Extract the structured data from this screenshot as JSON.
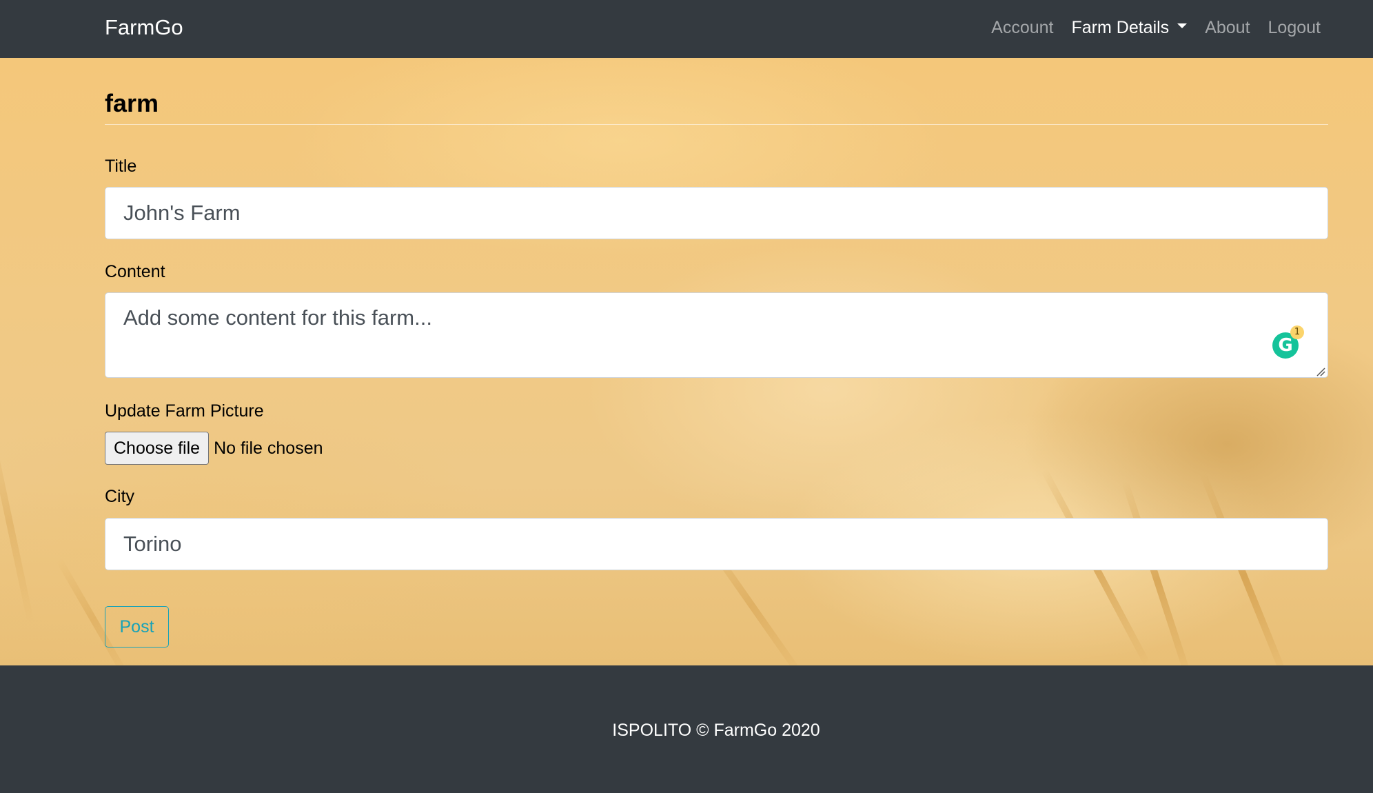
{
  "navbar": {
    "brand": "FarmGo",
    "links": [
      {
        "label": "Account",
        "active": false
      },
      {
        "label": "Farm Details",
        "active": true,
        "dropdown": true
      },
      {
        "label": "About",
        "active": false
      },
      {
        "label": "Logout",
        "active": false
      }
    ]
  },
  "form": {
    "heading": "farm",
    "title": {
      "label": "Title",
      "value": "John's Farm"
    },
    "content": {
      "label": "Content",
      "placeholder": "Add some content for this farm..."
    },
    "picture": {
      "label": "Update Farm Picture",
      "button": "Choose file",
      "status": "No file chosen"
    },
    "city": {
      "label": "City",
      "value": "Torino"
    },
    "submit": "Post"
  },
  "grammarly": {
    "icon": "grammarly-icon",
    "badge_count": "1"
  },
  "footer": {
    "text": "ISPOLITO © FarmGo 2020"
  },
  "colors": {
    "navbar_bg": "#343a40",
    "nav_link": "rgba(255,255,255,0.55)",
    "nav_link_active": "#ffffff",
    "post_outline": "#17a2b8",
    "grammarly_green": "#15c39a"
  }
}
